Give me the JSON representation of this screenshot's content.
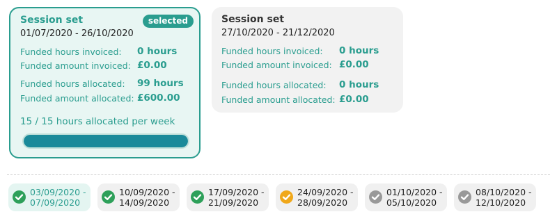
{
  "colors": {
    "accent": "#2a9d8f",
    "complete": "#2ea05a",
    "pending": "#f0a81a",
    "inactive": "#999999"
  },
  "session_sets": [
    {
      "title": "Session set",
      "dates": "01/07/2020 - 26/10/2020",
      "badge": "selected",
      "funded_hours_invoiced_label": "Funded hours invoiced:",
      "funded_hours_invoiced": "0 hours",
      "funded_amount_invoiced_label": "Funded amount invoiced:",
      "funded_amount_invoiced": "£0.00",
      "funded_hours_allocated_label": "Funded hours allocated:",
      "funded_hours_allocated": "99 hours",
      "funded_amount_allocated_label": "Funded amount allocated:",
      "funded_amount_allocated": "£600.00",
      "per_week": "15 / 15 hours allocated per week",
      "progress": 1.0
    },
    {
      "title": "Session set",
      "dates": "27/10/2020 - 21/12/2020",
      "funded_hours_invoiced_label": "Funded hours invoiced:",
      "funded_hours_invoiced": "0 hours",
      "funded_amount_invoiced_label": "Funded amount invoiced:",
      "funded_amount_invoiced": "£0.00",
      "funded_hours_allocated_label": "Funded hours allocated:",
      "funded_hours_allocated": "0 hours",
      "funded_amount_allocated_label": "Funded amount allocated:",
      "funded_amount_allocated": "£0.00"
    }
  ],
  "weeks": [
    {
      "line1": "03/09/2020 -",
      "line2": "07/09/2020",
      "status": "complete",
      "icon": "check-circle-icon"
    },
    {
      "line1": "10/09/2020 -",
      "line2": "14/09/2020",
      "status": "complete",
      "icon": "check-circle-icon"
    },
    {
      "line1": "17/09/2020 -",
      "line2": "21/09/2020",
      "status": "complete",
      "icon": "check-circle-icon"
    },
    {
      "line1": "24/09/2020 -",
      "line2": "28/09/2020",
      "status": "pending",
      "icon": "check-circle-icon"
    },
    {
      "line1": "01/10/2020 -",
      "line2": "05/10/2020",
      "status": "inactive",
      "icon": "check-circle-icon"
    },
    {
      "line1": "08/10/2020 -",
      "line2": "12/10/2020",
      "status": "inactive",
      "icon": "check-circle-icon"
    }
  ]
}
